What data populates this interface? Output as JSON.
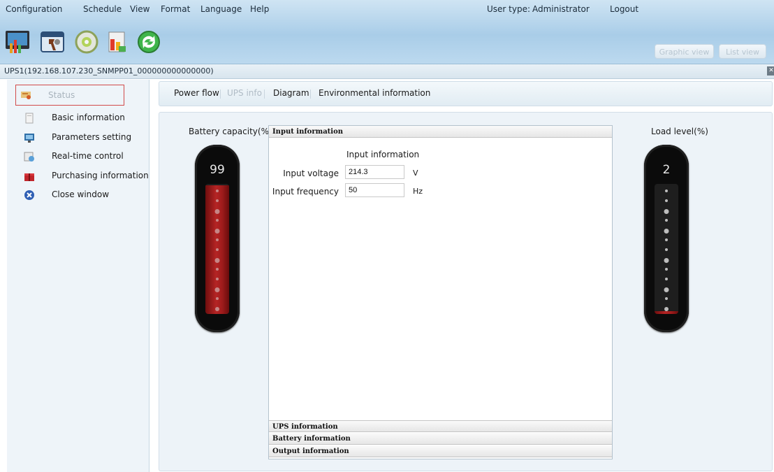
{
  "menu": {
    "items": [
      "Configuration",
      "Schedule",
      "View",
      "Format",
      "Language",
      "Help"
    ],
    "user_type_label": "User type:",
    "user_type_value": "Administrator",
    "logout": "Logout"
  },
  "toolbar": {
    "icons": [
      "monitor-chart-icon",
      "tools-config-icon",
      "disc-icon",
      "clipboard-report-icon",
      "refresh-icon"
    ],
    "graphic_view": "Graphic view",
    "list_view": "List view"
  },
  "device": {
    "title": "UPS1(192.168.107.230_SNMPP01_000000000000000)"
  },
  "sidebar": {
    "items": [
      {
        "label": "Status",
        "icon": "status-icon"
      },
      {
        "label": "Basic information",
        "icon": "document-icon"
      },
      {
        "label": "Parameters setting",
        "icon": "monitor-settings-icon"
      },
      {
        "label": "Real-time control",
        "icon": "control-icon"
      },
      {
        "label": "Purchasing information",
        "icon": "gift-icon"
      },
      {
        "label": "Close window",
        "icon": "close-circle-icon"
      }
    ]
  },
  "tabs": [
    "Power flow",
    "UPS info",
    "Diagram",
    "Environmental information"
  ],
  "battery": {
    "label": "Battery capacity(%)",
    "value": "99",
    "level": 0.99
  },
  "load": {
    "label": "Load level(%)",
    "value": "2",
    "level": 0.02
  },
  "info": {
    "section_input": "Input information",
    "form_title": "Input information",
    "fields": [
      {
        "label": "Input voltage",
        "value": "214.3",
        "unit": "V"
      },
      {
        "label": "Input frequency",
        "value": "50",
        "unit": "Hz"
      }
    ],
    "section_ups": "UPS information",
    "section_battery": "Battery information",
    "section_output": "Output information"
  },
  "colors": {
    "banner": "#b7d6ed",
    "gauge_fill": "#b52424",
    "active_border": "#d14a4a"
  }
}
